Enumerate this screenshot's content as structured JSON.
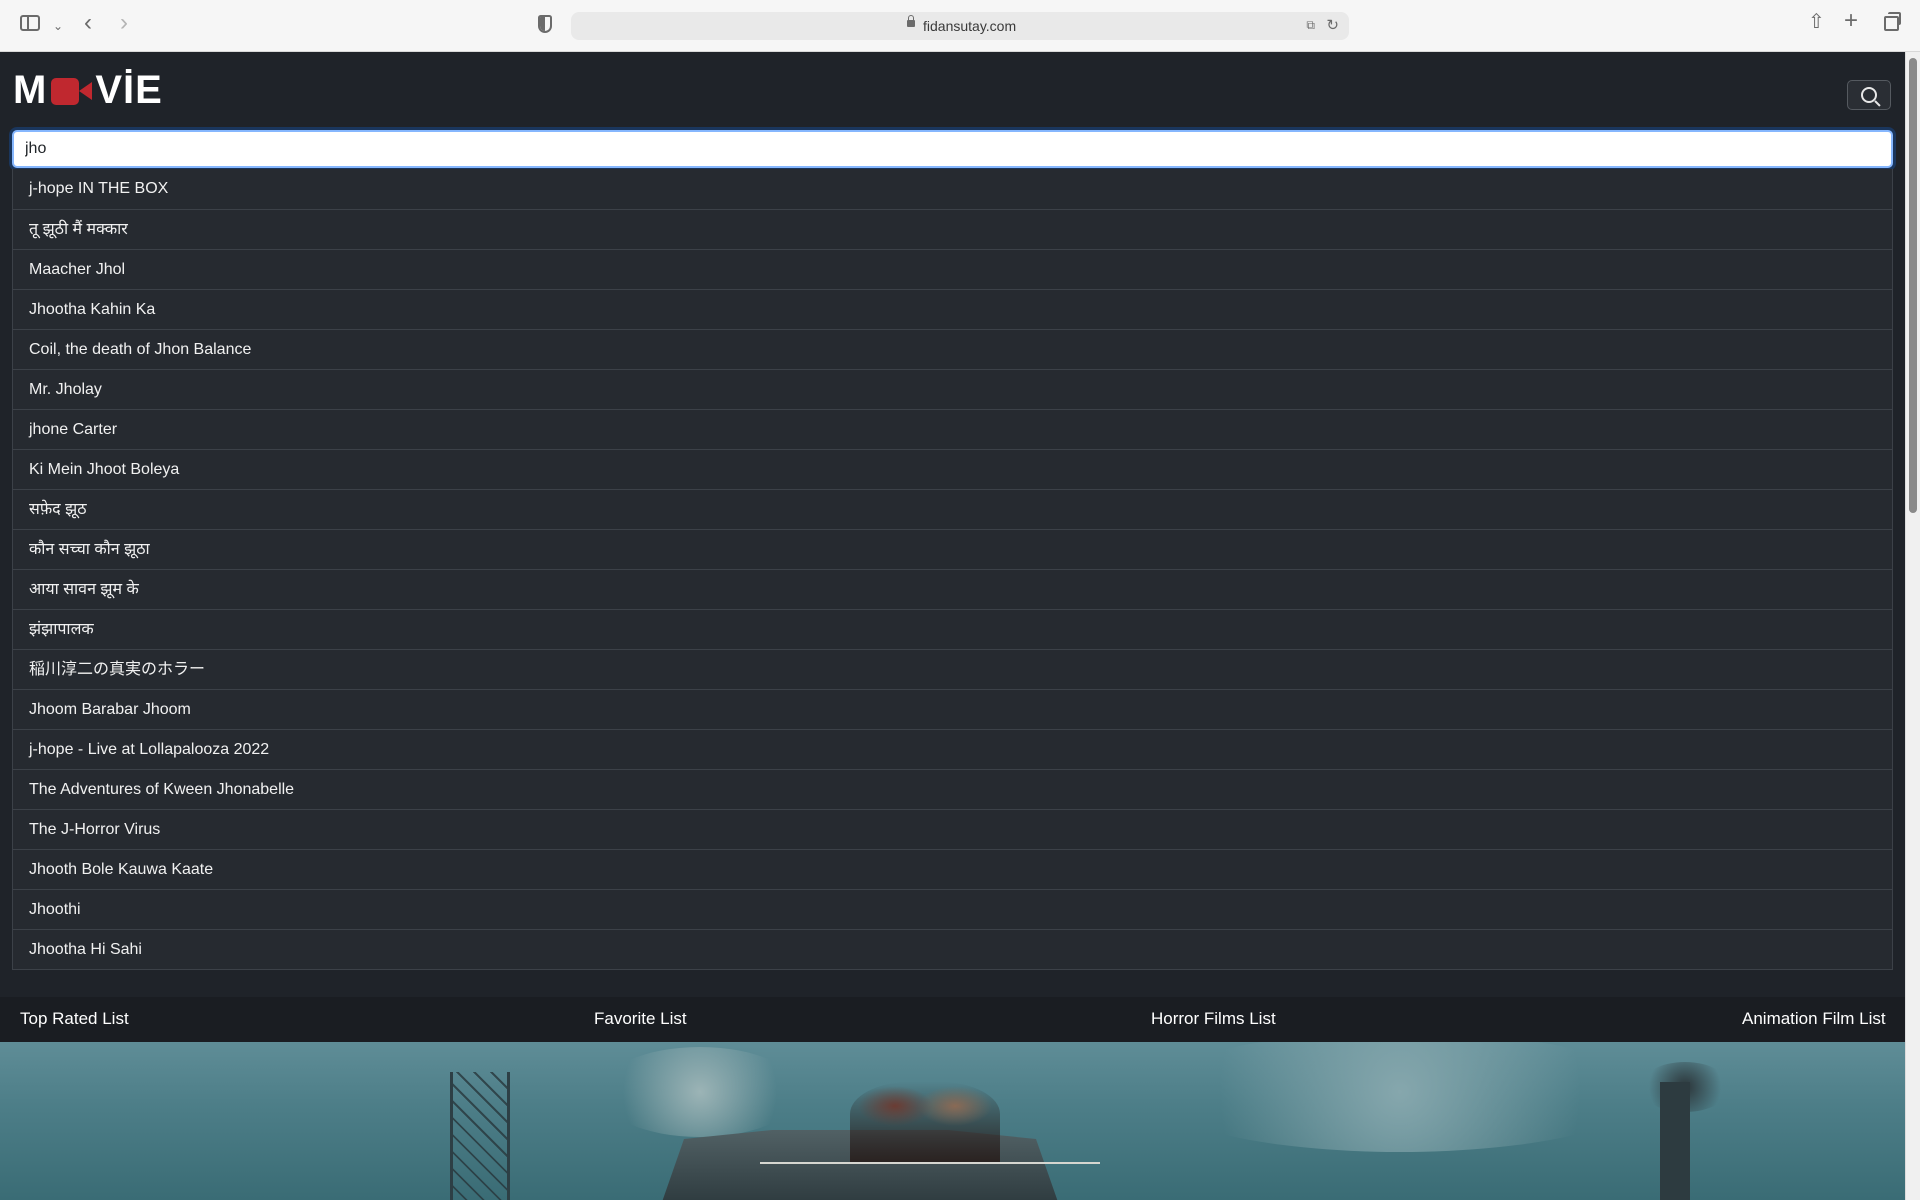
{
  "browser": {
    "url": "fidansutay.com"
  },
  "site": {
    "logo_left": "M",
    "logo_right": "VİE"
  },
  "search": {
    "value": "jho"
  },
  "results": [
    "j-hope IN THE BOX",
    "तू झूठी मैं मक्कार",
    "Maacher Jhol",
    "Jhootha Kahin Ka",
    "Coil, the death of Jhon Balance",
    "Mr. Jholay",
    "jhone Carter",
    "Ki Mein Jhoot Boleya",
    "सफ़ेद झूठ",
    "कौन सच्चा कौन झूठा",
    "आया सावन झूम के",
    "झंझापालक",
    "稲川淳二の真実のホラー",
    "Jhoom Barabar Jhoom",
    "j-hope - Live at Lollapalooza 2022",
    "The Adventures of Kween Jhonabelle",
    "The J-Horror Virus",
    "Jhooth Bole Kauwa Kaate",
    "Jhoothi",
    "Jhootha Hi Sahi"
  ],
  "lists": {
    "top_rated": "Top Rated List",
    "favorite": "Favorite List",
    "horror": "Horror Films List",
    "animation": "Animation Film List"
  },
  "colors": {
    "background": "#1f2329",
    "accent": "#c0282f",
    "focus": "#86b7fe"
  }
}
